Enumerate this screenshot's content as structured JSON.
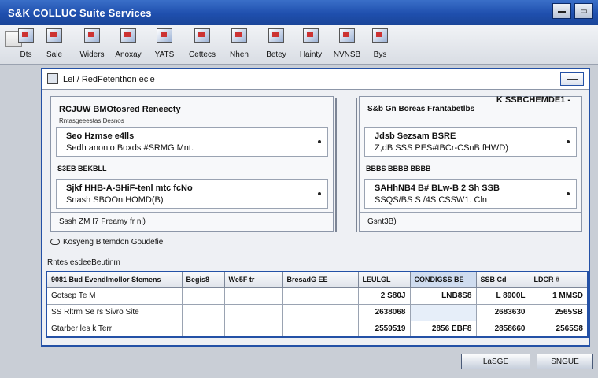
{
  "window": {
    "title": "S&K COLLUC Suite Services"
  },
  "toolbar": {
    "items": [
      {
        "label": "Dts",
        "icon": "folder-icon"
      },
      {
        "label": "Sale",
        "icon": "document-icon"
      },
      {
        "label": "Widers",
        "icon": "clipboard-icon"
      },
      {
        "label": "Anoxay",
        "icon": "card-icon"
      },
      {
        "label": "YATS",
        "icon": "receipt-icon"
      },
      {
        "label": "Cettecs",
        "icon": "list-icon"
      },
      {
        "label": "Nhen",
        "icon": "report-icon"
      },
      {
        "label": "Betey",
        "icon": "box-icon"
      },
      {
        "label": "Hainty",
        "icon": "calendar-icon"
      },
      {
        "label": "NVNSB",
        "icon": "chart-icon"
      },
      {
        "label": "Bys",
        "icon": "settings-icon"
      }
    ]
  },
  "panel": {
    "header_title": "Lel / RedFetenthon ecle",
    "left": {
      "title": "RCJUW BMOtosred Reneecty",
      "subtitle": "Rntasgeeestas Desnos",
      "row1": {
        "line1": "Seo  Hzmse e4lls",
        "line2": "Sedh  anonlo Boxds #SRMG Mnt."
      },
      "subhead": "S3EB  BEKBLL",
      "row2": {
        "line1": "Sjkf HHB-A-SHiF-tenl mtc  fcNo",
        "line2": "Snash SBOOntHOMD(B)"
      },
      "footer": "Sssh ZM  I7 Freamy fr nl)"
    },
    "right": {
      "title": "S&b Gn Boreas Frantabetlbs",
      "code": "K SSBCHEMDE1 -",
      "row1": {
        "line1": "Jdsb  Sezsam BSRE",
        "line2": "Z,dB SSS PES#tBCr-CSnB fHWD)"
      },
      "subhead": "BBBS  BBBB  BBBB",
      "row2": {
        "line1": "SAHhNB4 B# BLw-B  2  Sh SSB",
        "line2": "SSQS/BS S /4S CSSW1. Cln"
      },
      "footer": "Gsnt3B)"
    },
    "link_text": "Kosyeng Bitemdon Goudefie",
    "section_label": "Rntes esdeeBeutinm",
    "table": {
      "headers": [
        "9081 Bud Evendlmollor Stemens",
        "Begis8",
        "We5F tr",
        "BresadG EE",
        "LEULGL",
        "CONDIGSS BE",
        "SSB Cd",
        "LDCR #"
      ],
      "rows": [
        [
          "Gotsep   Te M",
          "",
          "",
          "",
          "2 S80J",
          "LNB8S8",
          "L 8900L",
          "1 MMSD"
        ],
        [
          "SS Rltrm   Se rs  Sivro Site",
          "",
          "",
          "",
          "2638068",
          "",
          "2683630",
          "2565SB"
        ],
        [
          "Gtarber  les  k Terr",
          "",
          "",
          "",
          "2559519",
          "2856 EBF8",
          "2858660",
          "2565S8"
        ]
      ]
    }
  },
  "buttons": {
    "ok": "LaSGE",
    "cancel": "SNGUE"
  }
}
